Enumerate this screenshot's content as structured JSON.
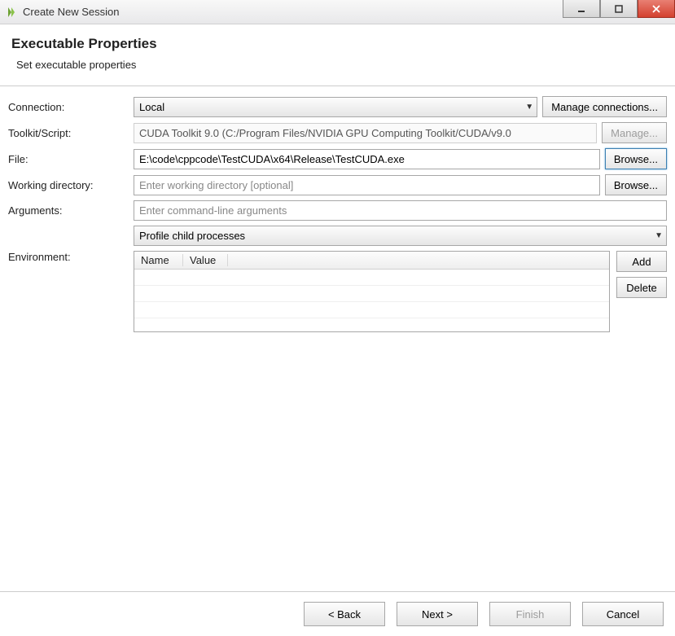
{
  "window": {
    "title": "Create New Session"
  },
  "header": {
    "title": "Executable Properties",
    "subtitle": "Set executable properties"
  },
  "form": {
    "connection": {
      "label": "Connection:",
      "value": "Local",
      "manage_btn": "Manage connections..."
    },
    "toolkit": {
      "label": "Toolkit/Script:",
      "value": "CUDA Toolkit 9.0 (C:/Program Files/NVIDIA GPU Computing Toolkit/CUDA/v9.0",
      "manage_btn": "Manage..."
    },
    "file": {
      "label": "File:",
      "value": "E:\\code\\cppcode\\TestCUDA\\x64\\Release\\TestCUDA.exe",
      "browse_btn": "Browse..."
    },
    "workdir": {
      "label": "Working directory:",
      "placeholder": "Enter working directory [optional]",
      "value": "",
      "browse_btn": "Browse..."
    },
    "arguments": {
      "label": "Arguments:",
      "placeholder": "Enter command-line arguments",
      "value": ""
    },
    "profile_mode": {
      "value": "Profile child processes"
    },
    "environment": {
      "label": "Environment:",
      "columns": {
        "name": "Name",
        "value": "Value"
      },
      "rows": [],
      "add_btn": "Add",
      "delete_btn": "Delete"
    }
  },
  "footer": {
    "back": "< Back",
    "next": "Next >",
    "finish": "Finish",
    "cancel": "Cancel"
  }
}
